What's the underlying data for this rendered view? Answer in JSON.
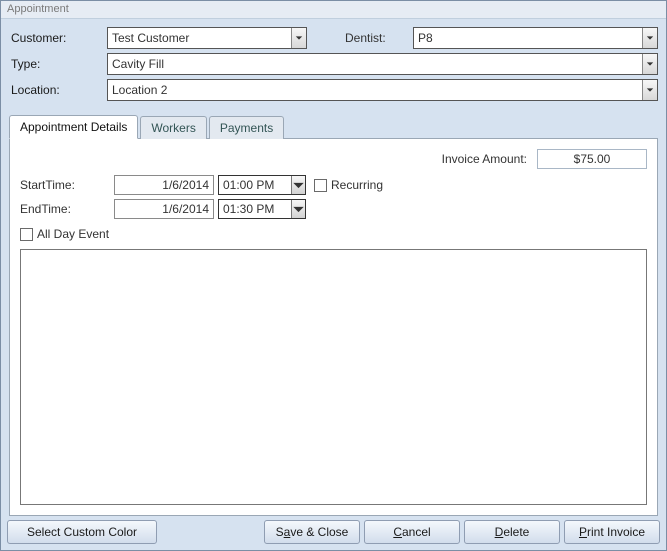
{
  "window": {
    "title": "Appointment"
  },
  "header": {
    "customer_label": "Customer:",
    "customer_value": "Test Customer",
    "dentist_label": "Dentist:",
    "dentist_value": "P8",
    "type_label": "Type:",
    "type_value": "Cavity Fill",
    "location_label": "Location:",
    "location_value": "Location 2"
  },
  "tabs": {
    "appointment_details": "Appointment Details",
    "workers": "Workers",
    "payments": "Payments",
    "active": "appointment_details"
  },
  "details": {
    "invoice_label": "Invoice Amount:",
    "invoice_value": "$75.00",
    "start_label": "StartTime:",
    "start_date": "1/6/2014",
    "start_time": "01:00 PM",
    "end_label": "EndTime:",
    "end_date": "1/6/2014",
    "end_time": "01:30 PM",
    "recurring_label": "Recurring",
    "all_day_label": "All Day Event",
    "notes": ""
  },
  "buttons": {
    "select_color": "Select Custom Color",
    "save_close_pre": "S",
    "save_close_u": "a",
    "save_close_post": "ve & Close",
    "cancel_u": "C",
    "cancel_post": "ancel",
    "delete_u": "D",
    "delete_post": "elete",
    "print_u": "P",
    "print_post": "rint Invoice"
  }
}
